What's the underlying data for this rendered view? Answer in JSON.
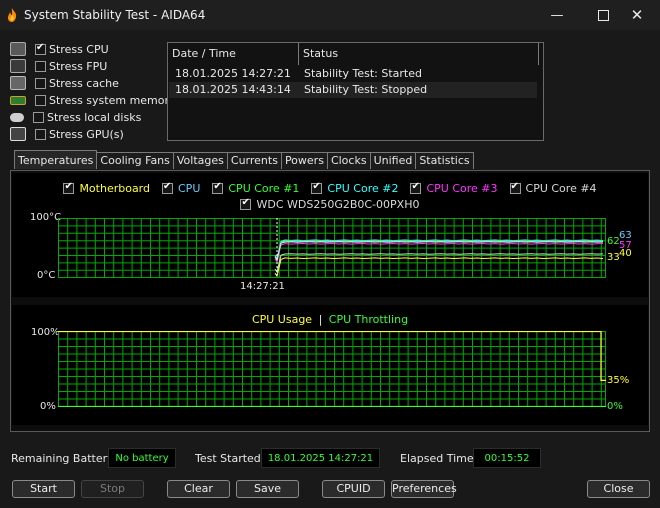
{
  "window": {
    "title": "System Stability Test - AIDA64"
  },
  "stress_options": [
    {
      "label": "Stress CPU",
      "checked": true,
      "icon": "cpu-chip-icon"
    },
    {
      "label": "Stress FPU",
      "checked": false,
      "icon": "fpu-chip-icon"
    },
    {
      "label": "Stress cache",
      "checked": false,
      "icon": "cache-chip-icon"
    },
    {
      "label": "Stress system memory",
      "checked": false,
      "icon": "memory-module-icon"
    },
    {
      "label": "Stress local disks",
      "checked": false,
      "icon": "disk-drive-icon"
    },
    {
      "label": "Stress GPU(s)",
      "checked": false,
      "icon": "monitor-icon"
    }
  ],
  "log": {
    "columns": [
      "Date / Time",
      "Status"
    ],
    "rows": [
      {
        "datetime": "18.01.2025 14:27:21",
        "status": "Stability Test: Started"
      },
      {
        "datetime": "18.01.2025 14:43:14",
        "status": "Stability Test: Stopped"
      }
    ]
  },
  "tabs": [
    "Temperatures",
    "Cooling Fans",
    "Voltages",
    "Currents",
    "Powers",
    "Clocks",
    "Unified",
    "Statistics"
  ],
  "active_tab": "Temperatures",
  "temp_graph": {
    "y_max_label": "100°C",
    "y_min_label": "0°C",
    "marker_time": "14:27:21",
    "legend": [
      {
        "label": "Motherboard",
        "color": "#ffff33",
        "checked": true
      },
      {
        "label": "CPU",
        "color": "#66ccff",
        "checked": true
      },
      {
        "label": "CPU Core #1",
        "color": "#33ff33",
        "checked": true
      },
      {
        "label": "CPU Core #2",
        "color": "#33ffff",
        "checked": true
      },
      {
        "label": "CPU Core #3",
        "color": "#ff33ff",
        "checked": true
      },
      {
        "label": "CPU Core #4",
        "color": "#d8d8d8",
        "checked": true
      },
      {
        "label": "WDC WDS250G2B0C-00PXH0",
        "color": "#d8d8d8",
        "checked": true
      }
    ],
    "end_labels": [
      {
        "text": "63",
        "color": "#66ccff"
      },
      {
        "text": "62",
        "color": "#33ff33"
      },
      {
        "text": "57",
        "color": "#ff33ff"
      },
      {
        "text": "33",
        "color": "#ffff33"
      },
      {
        "text": "40",
        "color": "#ffff33"
      }
    ]
  },
  "cpu_graph": {
    "legend_usage": "CPU Usage",
    "legend_sep": "|",
    "legend_throttling": "CPU Throttling",
    "usage_color": "#ffff33",
    "throttle_color": "#33ff33",
    "y_max_label": "100%",
    "y_min_label": "0%",
    "usage_value": "35%",
    "throttle_value": "0%"
  },
  "status": {
    "battery_label": "Remaining Battery:",
    "battery_value": "No battery",
    "started_label": "Test Started:",
    "started_value": "18.01.2025 14:27:21",
    "elapsed_label": "Elapsed Time:",
    "elapsed_value": "00:15:52"
  },
  "buttons": {
    "start": "Start",
    "stop": "Stop",
    "clear": "Clear",
    "save": "Save",
    "cpuid": "CPUID",
    "preferences": "Preferences",
    "close": "Close"
  },
  "colors": {
    "grid": "#00aa00",
    "background": "#191919"
  }
}
